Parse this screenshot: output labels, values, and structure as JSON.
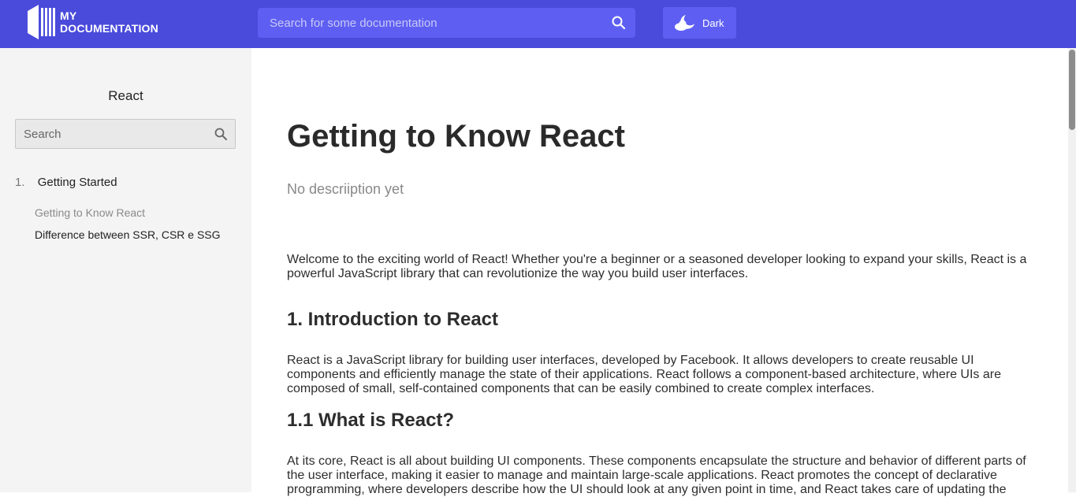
{
  "header": {
    "logo_line1": "MY",
    "logo_line2": "DOCUMENTATION",
    "search_placeholder": "Search for some documentation",
    "theme_label": "Dark"
  },
  "sidebar": {
    "title": "React",
    "search_placeholder": "Search",
    "section": {
      "number": "1.",
      "label": "Getting Started"
    },
    "items": [
      {
        "label": "Getting to Know React",
        "active": true
      },
      {
        "label": "Difference between SSR, CSR e SSG",
        "active": false
      }
    ]
  },
  "main": {
    "title": "Getting to Know React",
    "description": "No descriiption yet",
    "intro": "Welcome to the exciting world of React! Whether you're a beginner or a seasoned developer looking to expand your skills, React is a powerful JavaScript library that can revolutionize the way you build user interfaces.",
    "h_intro": "1. Introduction to React",
    "p_intro": "React is a JavaScript library for building user interfaces, developed by Facebook. It allows developers to create reusable UI components and efficiently manage the state of their applications. React follows a component-based architecture, where UIs are composed of small, self-contained components that can be easily combined to create complex interfaces.",
    "h_what": "1.1 What is React?",
    "p_what": "At its core, React is all about building UI components. These components encapsulate the structure and behavior of different parts of the user interface, making it easier to manage and maintain large-scale applications. React promotes the concept of declarative programming, where developers describe how the UI should look at any given point in time, and React takes care of updating the"
  },
  "colors": {
    "header_bg": "#4a4bdb",
    "header_control_bg": "#5e5ff2",
    "sidebar_bg": "#f4f4f4"
  },
  "icons": {
    "logo": "book-logo-icon",
    "search": "search-icon",
    "theme": "moon-cloud-icon",
    "sidebar_search": "search-icon"
  }
}
